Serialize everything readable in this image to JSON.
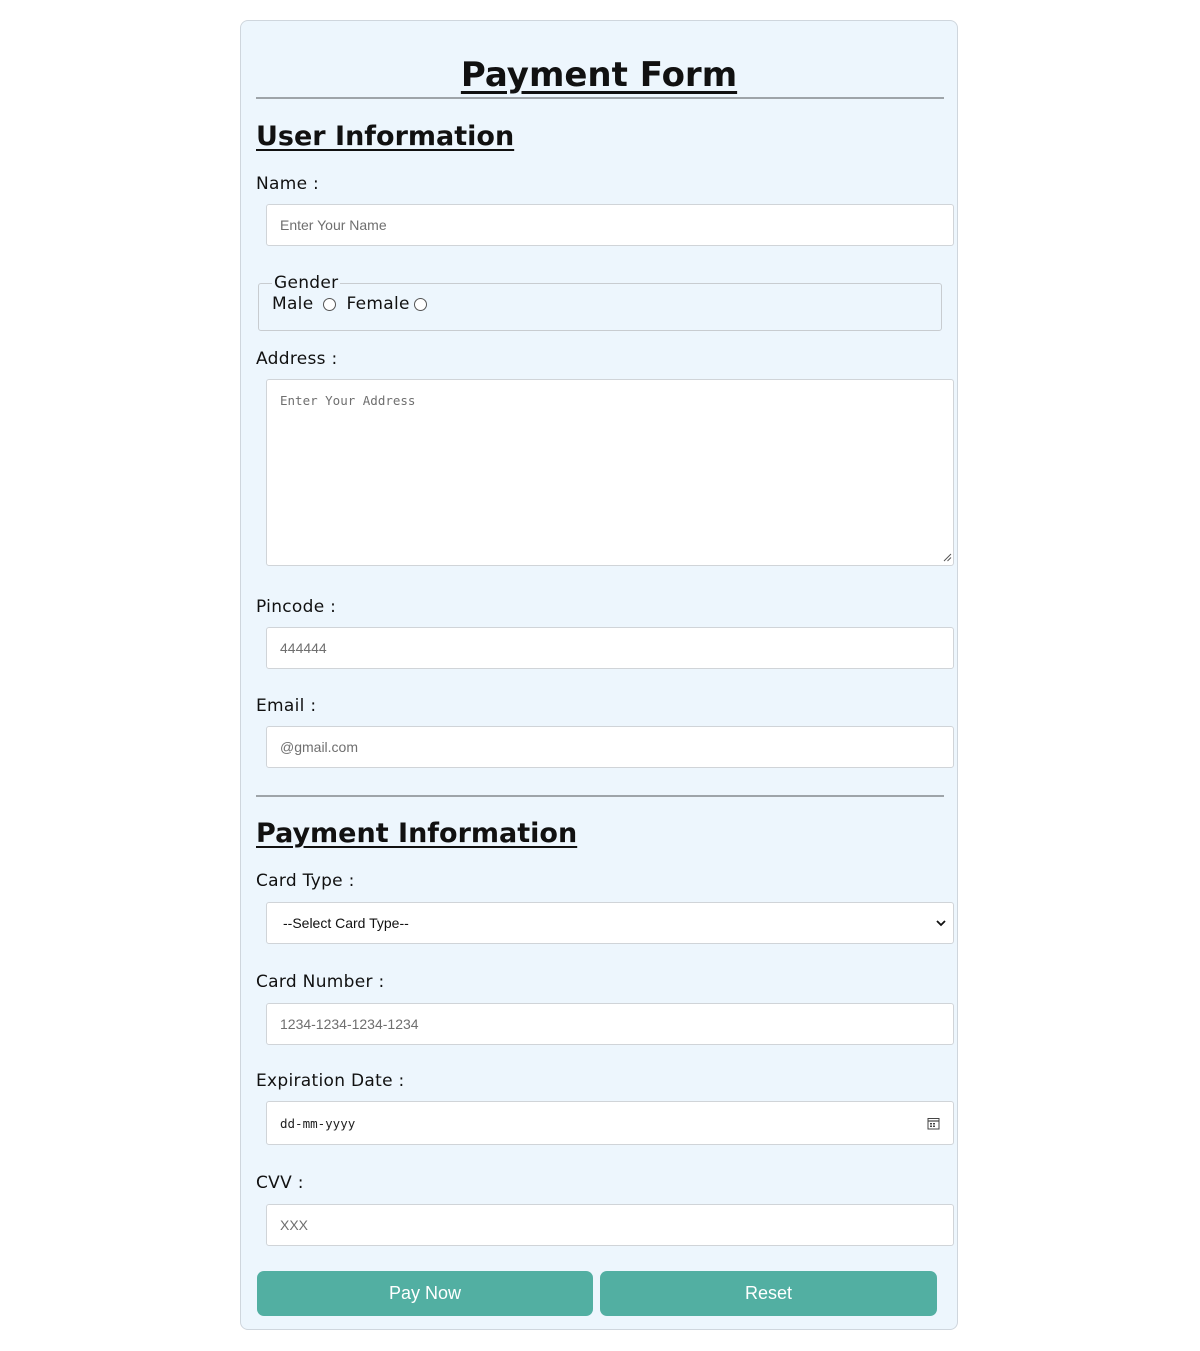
{
  "form": {
    "title": "Payment Form"
  },
  "user_info": {
    "heading": "User Information",
    "name": {
      "label": "Name :",
      "placeholder": "Enter Your Name"
    },
    "gender": {
      "legend": "Gender",
      "options": [
        "Male",
        "Female"
      ]
    },
    "address": {
      "label": "Address :",
      "placeholder": "Enter Your Address"
    },
    "pincode": {
      "label": "Pincode :",
      "placeholder": "444444"
    },
    "email": {
      "label": "Email :",
      "placeholder": "@gmail.com"
    }
  },
  "payment_info": {
    "heading": "Payment Information",
    "card_type": {
      "label": "Card Type :",
      "selected": "--Select Card Type--"
    },
    "card_number": {
      "label": "Card Number :",
      "placeholder": "1234-1234-1234-1234"
    },
    "expiration": {
      "label": "Expiration Date :",
      "placeholder": "dd-mm-yyyy"
    },
    "cvv": {
      "label": "CVV :",
      "placeholder": "XXX"
    }
  },
  "buttons": {
    "pay": "Pay Now",
    "reset": "Reset"
  },
  "colors": {
    "panel_background": "#edf6fd",
    "button": "#52afa2",
    "button_text": "#ffffff"
  },
  "icons": {
    "select": "chevron-down-icon",
    "date": "calendar-icon",
    "textarea": "resize-grip-icon"
  }
}
